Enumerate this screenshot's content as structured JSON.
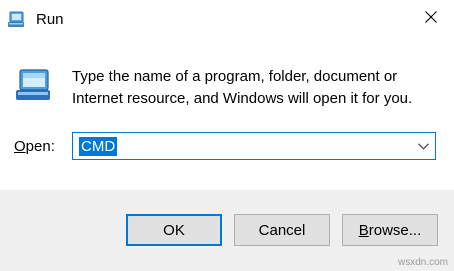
{
  "window": {
    "title": "Run"
  },
  "dialog": {
    "description": "Type the name of a program, folder, document or Internet resource, and Windows will open it for you.",
    "open_label": "Open:",
    "open_label_mnemonic": "O",
    "open_label_rest": "pen:",
    "input_value": "CMD"
  },
  "buttons": {
    "ok_label": "OK",
    "cancel_label": "Cancel",
    "browse_label_mnemonic": "B",
    "browse_label_rest": "rowse..."
  },
  "watermark": "wsxdn.com",
  "icons": {
    "app": "run-app-icon",
    "close": "close-icon",
    "dialog": "run-dialog-icon",
    "dropdown": "chevron-down-icon"
  },
  "colors": {
    "accent": "#0078d7",
    "footer_bg": "#f0f0f0",
    "button_bg": "#e1e1e1",
    "button_border": "#adadad"
  }
}
